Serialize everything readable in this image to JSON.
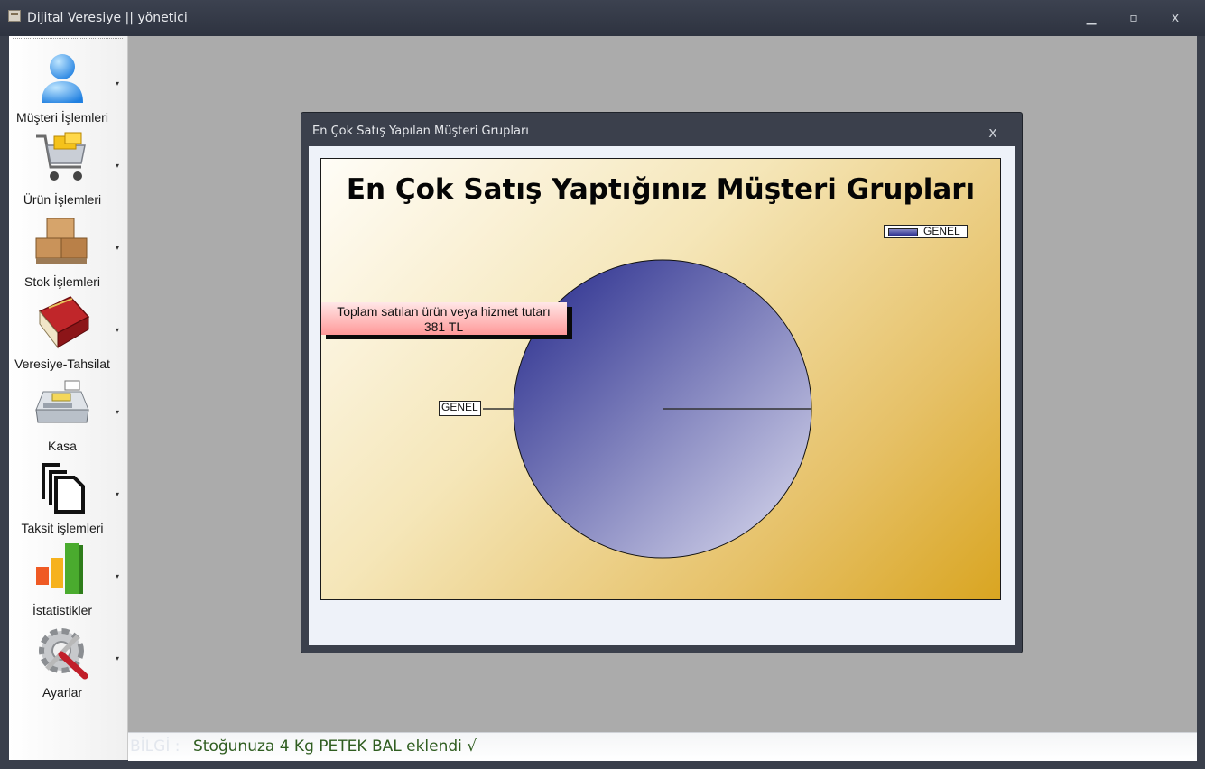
{
  "window": {
    "title": "Dijital Veresiye  ||  yönetici",
    "controls": {
      "minimize": "▁",
      "maximize": "▫",
      "close": "x"
    }
  },
  "sidebar": {
    "items": [
      {
        "label": "Müşteri İşlemleri",
        "icon": "user-icon"
      },
      {
        "label": "Ürün İşlemleri",
        "icon": "shopping-cart-icon"
      },
      {
        "label": "Stok İşlemleri",
        "icon": "boxes-icon"
      },
      {
        "label": "Veresiye-Tahsilat",
        "icon": "ledger-book-icon"
      },
      {
        "label": "Kasa",
        "icon": "cash-register-icon"
      },
      {
        "label": "Taksit işlemleri",
        "icon": "documents-icon"
      },
      {
        "label": "İstatistikler",
        "icon": "bar-chart-icon"
      },
      {
        "label": "Ayarlar",
        "icon": "settings-gear-icon"
      }
    ],
    "arrow": "▾"
  },
  "dialog": {
    "title": "En Çok Satış Yapılan Müşteri Grupları",
    "close": "x"
  },
  "chart_data": {
    "type": "pie",
    "title": "En Çok Satış Yaptığınız Müşteri Grupları",
    "categories": [
      "GENEL"
    ],
    "values": [
      381
    ],
    "series": [
      {
        "name": "GENEL",
        "values": [
          381
        ]
      }
    ],
    "slice_labels": [
      "GENEL"
    ],
    "legend": {
      "entries": [
        "GENEL"
      ],
      "position": "top-right"
    },
    "annotation": {
      "line1": "Toplam satılan ürün veya hizmet tutarı",
      "line2": "381 TL"
    },
    "colors": {
      "slice_dark": "#23278a",
      "slice_light": "#dcdcef",
      "background_light": "#fffdf7",
      "background_dark": "#d9a521"
    }
  },
  "statusbar": {
    "prefix": "BİLGİ :",
    "message": "Stoğunuza 4 Kg PETEK BAL eklendi  √"
  }
}
